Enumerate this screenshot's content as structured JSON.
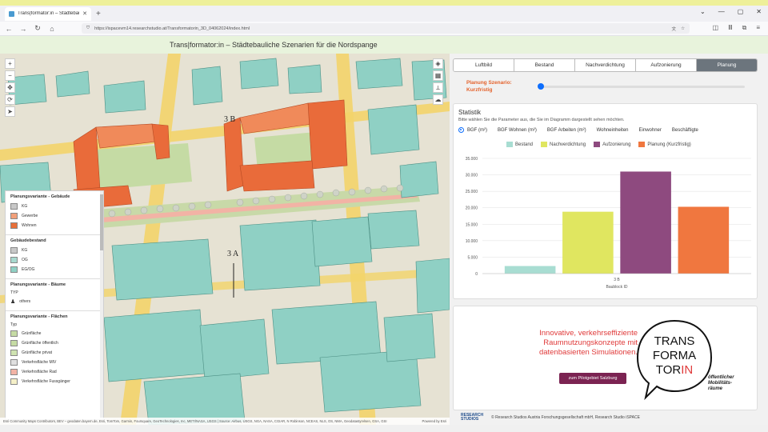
{
  "browser": {
    "tab_title": "Trans|formator:in – Städtebaul",
    "url": "https://ispacevm14.researchstudio.at/Transformatorin_3D_04062024/index.html"
  },
  "app": {
    "title": "Trans|formator:in – Städtebauliche Szenarien für die Nordspange"
  },
  "map": {
    "label_3b": "3 B",
    "label_3a": "3 A",
    "attribution": "Esri Community Maps Contributors, BEV – geodaten.bayern.de, Esri, TomTom, Garmin, Foursquare, GeoTechnologies, Inc, METI/NASA, USGS | Source: Airbus, USGS, NGA, NASA, CGIAR, N Robinson, NCEAS, NLS, OS, NMA, Geodatastyrelsen, GSA, GSI",
    "powered": "Powered by Esri",
    "colors": {
      "existing": "#8fd0c4",
      "planned": "#e96b3a",
      "green": "#c5dba4",
      "road": "#f3d46a"
    }
  },
  "legend": {
    "sections": [
      {
        "title": "Planungsvariante - Gebäude",
        "items": [
          {
            "label": "KG",
            "color": "#c8c8c8"
          },
          {
            "label": "Gewerbe",
            "color": "#f2a07a"
          },
          {
            "label": "Wohnen",
            "color": "#e8703a"
          }
        ]
      },
      {
        "title": "Gebäudebestand",
        "items": [
          {
            "label": "KG",
            "color": "#c8c8c8"
          },
          {
            "label": "OG",
            "color": "#a8d9cf"
          },
          {
            "label": "EG/OG",
            "color": "#8fd0c4"
          }
        ]
      },
      {
        "title": "Planungsvariante - Bäume",
        "type_label": "TYP",
        "items": [
          {
            "label": "others",
            "color": "#ffffff"
          }
        ]
      },
      {
        "title": "Planungsvariante - Flächen",
        "type_label": "Typ",
        "items": [
          {
            "label": "Grünfläche",
            "color": "#c5dba4"
          },
          {
            "label": "Grünfläche öffentlich",
            "color": "#c5dba4"
          },
          {
            "label": "Grünfläche privat",
            "color": "#cfe3b1"
          },
          {
            "label": "Verkehrsfläche MIV",
            "color": "#e0e0e0"
          },
          {
            "label": "Verkehrsfläche Rad",
            "color": "#f2b3a5"
          },
          {
            "label": "Verkehrsfläche Fussgänger",
            "color": "#f5f0c8"
          }
        ]
      }
    ]
  },
  "panel": {
    "tabs": [
      "Luftbild",
      "Bestand",
      "Nachverdichtung",
      "Aufzonierung",
      "Planung"
    ],
    "active_tab": "Planung",
    "scenario_label_1": "Planung Szenario:",
    "scenario_label_2": "Kurzfristig",
    "stats_title": "Statistik",
    "stats_sub": "Bitte wählen Sie die Parameter aus, die Sie im Diagramm dargestellt sehen möchten.",
    "radios": [
      "BGF (m²)",
      "BGF Wohnen (m²)",
      "BGF Arbeiten (m²)",
      "Wohneinheiten",
      "Einwohner",
      "Beschäftigte"
    ],
    "promo_line1": "Innovative, verkehrseffiziente",
    "promo_line2": "Raumnutzungskonzepte mit",
    "promo_line3": "datenbasierten Simulationen.",
    "promo_button": "zum Pilotgebiet Salzburg",
    "logo_l1": "TRANS",
    "logo_l2": "FORMA",
    "logo_l3a": "TOR",
    "logo_l3b": "IN",
    "logo_sub1": "öffentlicher",
    "logo_sub2": "Mobilitäts-",
    "logo_sub3": "räume",
    "footer_brand": "RESEARCH STUDIOS",
    "footer_copy": "© Research Studios Austria Forschungsgesellschaft mbH, Research Studio iSPACE"
  },
  "chart_data": {
    "type": "bar",
    "categories": [
      "3 B"
    ],
    "xlabel": "Baublock ID",
    "ylabel": "",
    "ylim": [
      0,
      35000
    ],
    "yticks": [
      0,
      5000,
      10000,
      15000,
      20000,
      25000,
      30000,
      35000
    ],
    "ytick_labels": [
      "0",
      "5.000",
      "10.000",
      "15.000",
      "20.000",
      "25.000",
      "30.000",
      "35.000"
    ],
    "grid": true,
    "legend": "top",
    "series": [
      {
        "name": "Bestand",
        "values": [
          2300
        ],
        "color": "#a8ddd2"
      },
      {
        "name": "Nachverdichtung",
        "values": [
          18800
        ],
        "color": "#e0e660"
      },
      {
        "name": "Aufzonierung",
        "values": [
          31000
        ],
        "color": "#8e4a7f"
      },
      {
        "name": "Planung (Kurzfristig)",
        "values": [
          20300
        ],
        "color": "#f0773f"
      }
    ]
  }
}
